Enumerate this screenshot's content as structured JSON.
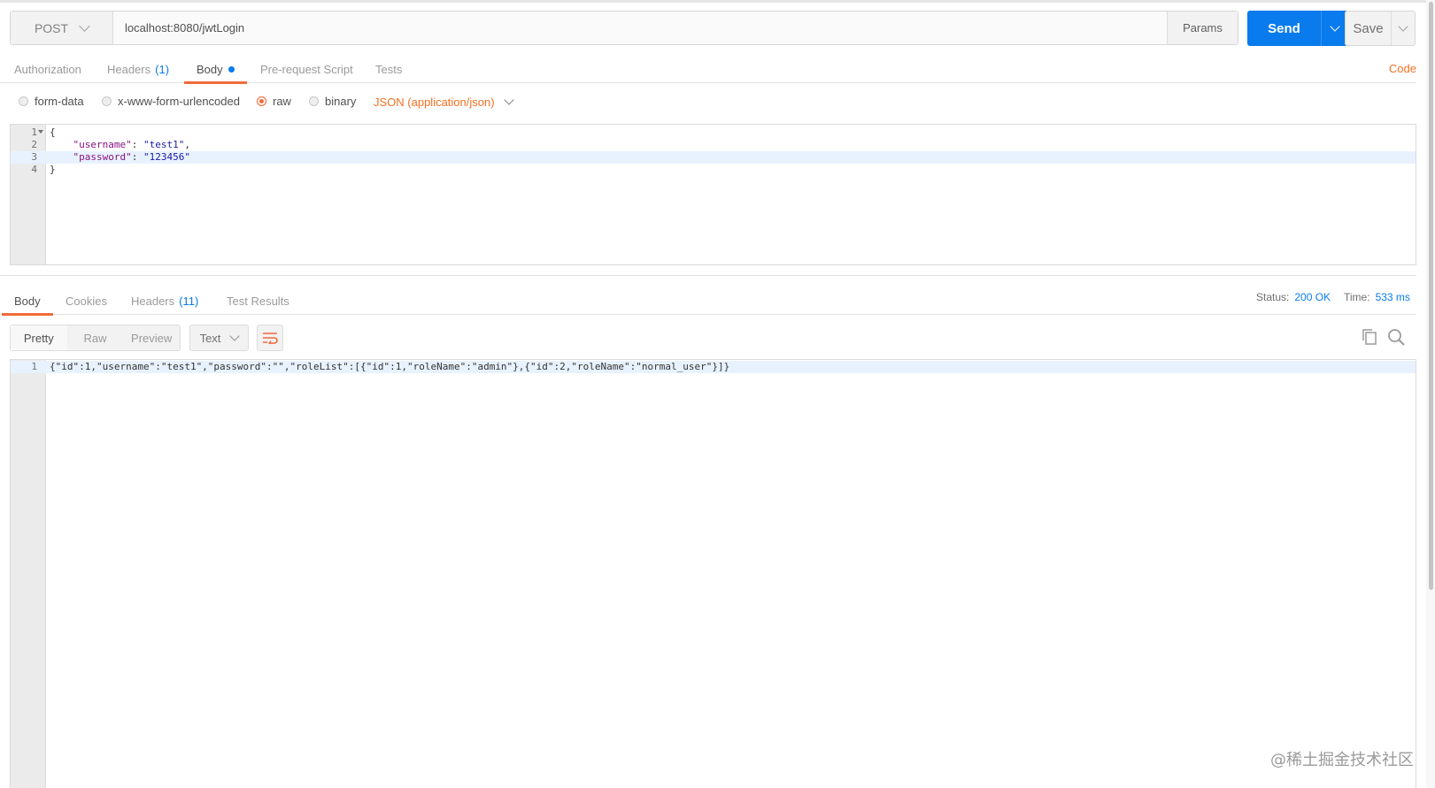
{
  "request": {
    "method": "POST",
    "url": "localhost:8080/jwtLogin",
    "params_label": "Params",
    "send_label": "Send",
    "save_label": "Save",
    "code_link": "Code",
    "tabs": [
      {
        "label": "Authorization",
        "count": ""
      },
      {
        "label": "Headers",
        "count": "(1)"
      },
      {
        "label": "Body",
        "count": ""
      },
      {
        "label": "Pre-request Script",
        "count": ""
      },
      {
        "label": "Tests",
        "count": ""
      }
    ],
    "body_types": [
      "form-data",
      "x-www-form-urlencoded",
      "raw",
      "binary"
    ],
    "selected_body_type": "raw",
    "content_type": "JSON (application/json)",
    "body_lines": [
      {
        "n": "1",
        "text": "{"
      },
      {
        "n": "2",
        "key": "\"username\"",
        "val": "\"test1\"",
        "suffix": ","
      },
      {
        "n": "3",
        "key": "\"password\"",
        "val": "\"123456\"",
        "suffix": ""
      },
      {
        "n": "4",
        "text": "}"
      }
    ]
  },
  "response": {
    "tabs": [
      {
        "label": "Body",
        "count": ""
      },
      {
        "label": "Cookies",
        "count": ""
      },
      {
        "label": "Headers",
        "count": "(11)"
      },
      {
        "label": "Test Results",
        "count": ""
      }
    ],
    "status_label": "Status:",
    "status_value": "200 OK",
    "time_label": "Time:",
    "time_value": "533 ms",
    "views": [
      "Pretty",
      "Raw",
      "Preview"
    ],
    "format": "Text",
    "body_lines": [
      {
        "n": "1",
        "text": "{\"id\":1,\"username\":\"test1\",\"password\":\"\",\"roleList\":[{\"id\":1,\"roleName\":\"admin\"},{\"id\":2,\"roleName\":\"normal_user\"}]}"
      }
    ]
  },
  "watermark": "@稀土掘金技术社区",
  "colors": {
    "accent": "#097bed",
    "active_tab": "#f26b3a",
    "code_link": "#f47023"
  }
}
